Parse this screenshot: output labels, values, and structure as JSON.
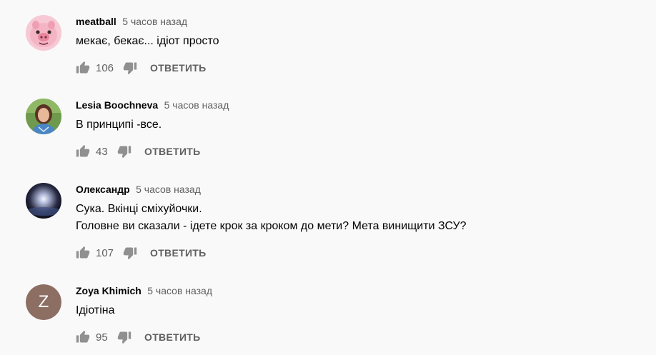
{
  "reply_label": "ОТВЕТИТЬ",
  "colors": {
    "background": "#f9f9f9",
    "author_text": "#030303",
    "meta_text": "#606060",
    "avatar_z_bg": "#8d6e63"
  },
  "comments": [
    {
      "author": "meatball",
      "time": "5 часов назад",
      "text": "мекає, бекає... ідіот просто",
      "likes": "106",
      "avatar_icon": "pig-avatar"
    },
    {
      "author": "Lesia Boochneva",
      "time": "5 часов назад",
      "text": "В принципі -все.",
      "likes": "43",
      "avatar_icon": "woman-photo-avatar"
    },
    {
      "author": "Олександр",
      "time": "5 часов назад",
      "text": "Сука. Вкінці сміхуйочки.\nГоловне ви сказали - ідете крок за кроком до мети? Мета винищити ЗСУ?",
      "likes": "107",
      "avatar_icon": "night-sky-avatar"
    },
    {
      "author": "Zoya Khimich",
      "time": "5 часов назад",
      "text": "Ідіотіна",
      "likes": "95",
      "avatar_letter": "Z"
    }
  ]
}
